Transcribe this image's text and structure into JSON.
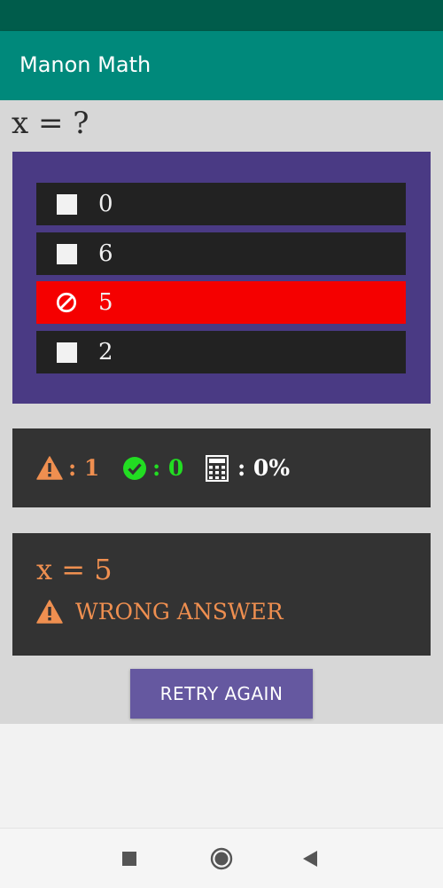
{
  "app": {
    "title": "Manon Math"
  },
  "question": {
    "text": "x = ?"
  },
  "options": [
    {
      "label": "0",
      "state": "unchecked"
    },
    {
      "label": "6",
      "state": "unchecked"
    },
    {
      "label": "5",
      "state": "wrong"
    },
    {
      "label": "2",
      "state": "unchecked"
    }
  ],
  "stats": {
    "wrong": {
      "icon": "warning-icon",
      "text": ": 1",
      "color": "#ef8f50"
    },
    "correct": {
      "icon": "check-circle-icon",
      "text": ": 0",
      "color": "#22dd22"
    },
    "score": {
      "icon": "calculator-icon",
      "text": ": 0%",
      "color": "#ffffff"
    }
  },
  "result": {
    "equation": "x = 5",
    "message": "WRONG ANSWER",
    "icon": "warning-icon",
    "color": "#ef8f50"
  },
  "retry": {
    "label": "RETRY AGAIN"
  },
  "navigation": {
    "recents_icon": "square-icon",
    "home_icon": "circle-icon",
    "back_icon": "triangle-back-icon"
  },
  "colors": {
    "app_bar": "#00897b",
    "status_bar": "#005c4b",
    "options_panel": "#4a3a84",
    "option_row": "#222222",
    "wrong_row": "#f50000",
    "button": "#6558a0"
  }
}
